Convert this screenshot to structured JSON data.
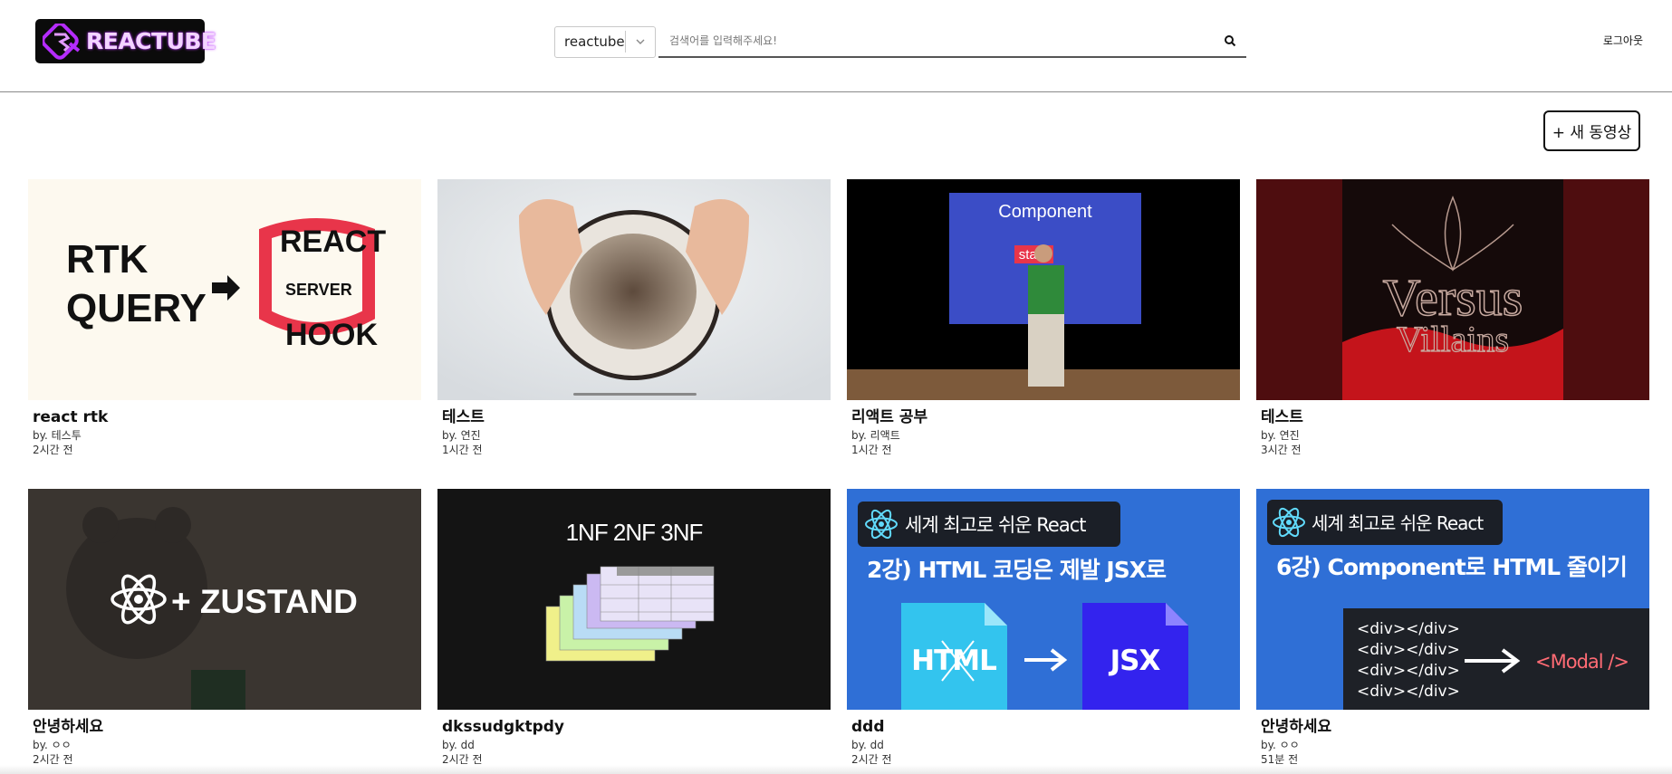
{
  "header": {
    "logo_text": "REACTUBE",
    "search": {
      "filter_value": "reactube",
      "placeholder": "검색어를 입력해주세요!"
    },
    "logout_label": "로그아웃"
  },
  "new_video_label": "+ 새 동영상",
  "videos": [
    {
      "title": "react rtk",
      "by": "by. 테스투",
      "time": "2시간 전",
      "thumb_text": [
        "RTK",
        "QUERY",
        "REACT",
        "SERVER",
        "HOOK"
      ]
    },
    {
      "title": "테스트",
      "by": "by. 연진",
      "time": "1시간 전"
    },
    {
      "title": "리액트 공부",
      "by": "by. 리액트",
      "time": "1시간 전",
      "thumb_text": [
        "Component",
        "state"
      ]
    },
    {
      "title": "테스트",
      "by": "by. 연진",
      "time": "3시간 전",
      "thumb_text": [
        "Versus",
        "Villains"
      ]
    },
    {
      "title": "안녕하세요",
      "by": "by. ㅇㅇ",
      "time": "2시간 전",
      "thumb_text": [
        "+ ZUSTAND"
      ]
    },
    {
      "title": "dkssudgktpdy",
      "by": "by. dd",
      "time": "2시간 전",
      "thumb_text": [
        "1NF 2NF 3NF"
      ]
    },
    {
      "title": "ddd",
      "by": "by. dd",
      "time": "2시간 전",
      "thumb_text": [
        "세계 최고로 쉬운 React",
        "2강) HTML 코딩은 제발 JSX로",
        "HTML",
        "JSX"
      ]
    },
    {
      "title": "안녕하세요",
      "by": "by. ㅇㅇ",
      "time": "51분 전",
      "thumb_text": [
        "세계 최고로 쉬운 React",
        "6강) Component로 HTML 줄이기",
        "<div></div>",
        "<Modal />"
      ]
    }
  ],
  "colors": {
    "logo_glow": "#c23bff",
    "react_blue": "#2f6fd6",
    "accent_red": "#e8354a"
  }
}
